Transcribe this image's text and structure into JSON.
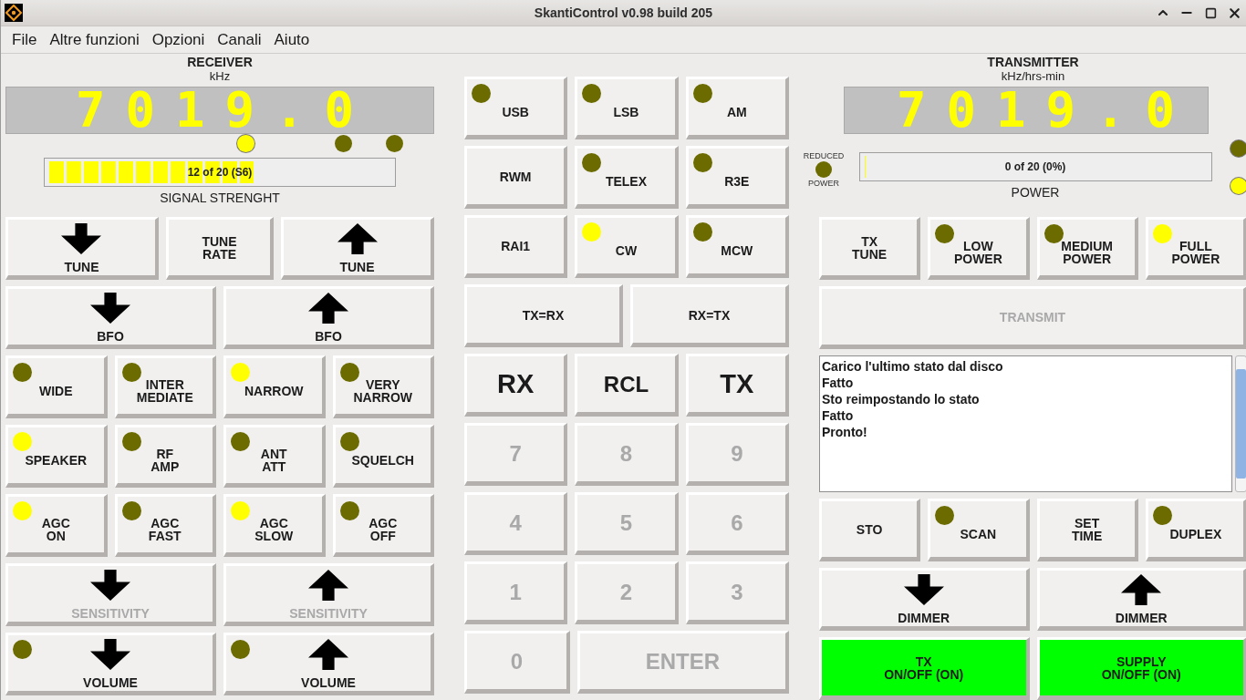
{
  "window": {
    "title": "SkantiControl v0.98 build 205"
  },
  "menu": [
    "File",
    "Altre funzioni",
    "Opzioni",
    "Canali",
    "Aiuto"
  ],
  "receiver": {
    "title": "RECEIVER",
    "unit": "kHz",
    "frequency": "7019.0",
    "lamps": [
      {
        "on": true
      },
      {
        "on": false
      },
      {
        "on": false
      }
    ],
    "signal": {
      "level": 0.6,
      "reading": "12 of 20 (S6)",
      "label": "SIGNAL STRENGHT"
    },
    "button_rows": [
      [
        {
          "kind": "down",
          "label": "TUNE"
        },
        {
          "kind": "plain",
          "label": "TUNE\nRATE"
        },
        {
          "kind": "up",
          "label": "TUNE"
        }
      ],
      [
        {
          "kind": "down",
          "label": "BFO"
        },
        {
          "kind": "up",
          "label": "BFO"
        }
      ],
      [
        {
          "kind": "plain",
          "label": "WIDE",
          "lamp_on": false
        },
        {
          "kind": "plain",
          "label": "INTER\nMEDIATE",
          "lamp_on": false
        },
        {
          "kind": "plain",
          "label": "NARROW",
          "lamp_on": true
        },
        {
          "kind": "plain",
          "label": "VERY\nNARROW",
          "lamp_on": false
        }
      ],
      [
        {
          "kind": "plain",
          "label": "SPEAKER",
          "lamp_on": true
        },
        {
          "kind": "plain",
          "label": "RF\nAMP",
          "lamp_on": false
        },
        {
          "kind": "plain",
          "label": "ANT\nATT",
          "lamp_on": false
        },
        {
          "kind": "plain",
          "label": "SQUELCH",
          "lamp_on": false
        }
      ],
      [
        {
          "kind": "plain",
          "label": "AGC\nON",
          "lamp_on": true
        },
        {
          "kind": "plain",
          "label": "AGC\nFAST",
          "lamp_on": false
        },
        {
          "kind": "plain",
          "label": "AGC\nSLOW",
          "lamp_on": true
        },
        {
          "kind": "plain",
          "label": "AGC\nOFF",
          "lamp_on": false
        }
      ],
      [
        {
          "kind": "down",
          "label": "SENSITIVITY",
          "disabled": true
        },
        {
          "kind": "up",
          "label": "SENSITIVITY",
          "disabled": true
        }
      ],
      [
        {
          "kind": "down",
          "label": "VOLUME",
          "lamp_on": false
        },
        {
          "kind": "up",
          "label": "VOLUME",
          "lamp_on": false
        }
      ]
    ]
  },
  "keypad": {
    "button_rows": [
      [
        {
          "kind": "plain",
          "label": "USB",
          "lamp_on": false
        },
        {
          "kind": "plain",
          "label": "LSB",
          "lamp_on": false
        },
        {
          "kind": "plain",
          "label": "AM",
          "lamp_on": false
        }
      ],
      [
        {
          "kind": "plain",
          "label": "RWM"
        },
        {
          "kind": "plain",
          "label": "TELEX",
          "lamp_on": false
        },
        {
          "kind": "plain",
          "label": "R3E",
          "lamp_on": false
        }
      ],
      [
        {
          "kind": "plain",
          "label": "RAI1"
        },
        {
          "kind": "plain",
          "label": "CW",
          "lamp_on": true
        },
        {
          "kind": "plain",
          "label": "MCW",
          "lamp_on": false
        }
      ],
      [
        {
          "kind": "plain",
          "label": "TX=RX"
        },
        {
          "kind": "plain",
          "label": "RX=TX"
        }
      ],
      [
        {
          "kind": "big",
          "label": "RX"
        },
        {
          "kind": "key",
          "label": "RCL"
        },
        {
          "kind": "big",
          "label": "TX"
        }
      ],
      [
        {
          "kind": "key",
          "label": "7",
          "disabled": true
        },
        {
          "kind": "key",
          "label": "8",
          "disabled": true
        },
        {
          "kind": "key",
          "label": "9",
          "disabled": true
        }
      ],
      [
        {
          "kind": "key",
          "label": "4",
          "disabled": true
        },
        {
          "kind": "key",
          "label": "5",
          "disabled": true
        },
        {
          "kind": "key",
          "label": "6",
          "disabled": true
        }
      ],
      [
        {
          "kind": "key",
          "label": "1",
          "disabled": true
        },
        {
          "kind": "key",
          "label": "2",
          "disabled": true
        },
        {
          "kind": "key",
          "label": "3",
          "disabled": true
        }
      ],
      [
        {
          "kind": "key",
          "label": "0",
          "disabled": true
        },
        {
          "kind": "wide_key",
          "label": "ENTER",
          "disabled": true
        }
      ]
    ]
  },
  "transmitter": {
    "title": "TRANSMITTER",
    "unit": "kHz/hrs-min",
    "frequency": "7019.0",
    "reduced_power": {
      "label_top": "REDUCED",
      "label_bottom": "POWER",
      "on": false
    },
    "power": {
      "level": 0,
      "reading": "0 of 20 (0%)",
      "label": "POWER"
    },
    "lamps": [
      {
        "on": false
      },
      {
        "on": true
      }
    ],
    "button_rows": [
      [
        {
          "kind": "plain",
          "label": "TX\nTUNE"
        },
        {
          "kind": "plain",
          "label": "LOW\nPOWER",
          "lamp_on": false
        },
        {
          "kind": "plain",
          "label": "MEDIUM\nPOWER",
          "lamp_on": false
        },
        {
          "kind": "plain",
          "label": "FULL\nPOWER",
          "lamp_on": true
        }
      ],
      [
        {
          "kind": "plain",
          "label": "TRANSMIT",
          "disabled": true
        }
      ]
    ],
    "log": [
      "Carico l'ultimo stato dal disco",
      "Fatto",
      "Sto reimpostando lo stato",
      "Fatto",
      "Pronto!"
    ],
    "bottom_rows": [
      [
        {
          "kind": "plain",
          "label": "STO"
        },
        {
          "kind": "plain",
          "label": "SCAN",
          "lamp_on": false
        },
        {
          "kind": "plain",
          "label": "SET\nTIME"
        },
        {
          "kind": "plain",
          "label": "DUPLEX",
          "lamp_on": false
        }
      ],
      [
        {
          "kind": "down",
          "label": "DIMMER"
        },
        {
          "kind": "up",
          "label": "DIMMER"
        }
      ],
      [
        {
          "kind": "plain",
          "label": "TX\nON/OFF (ON)",
          "active": true
        },
        {
          "kind": "plain",
          "label": "SUPPLY\nON/OFF (ON)",
          "active": true
        }
      ]
    ]
  }
}
